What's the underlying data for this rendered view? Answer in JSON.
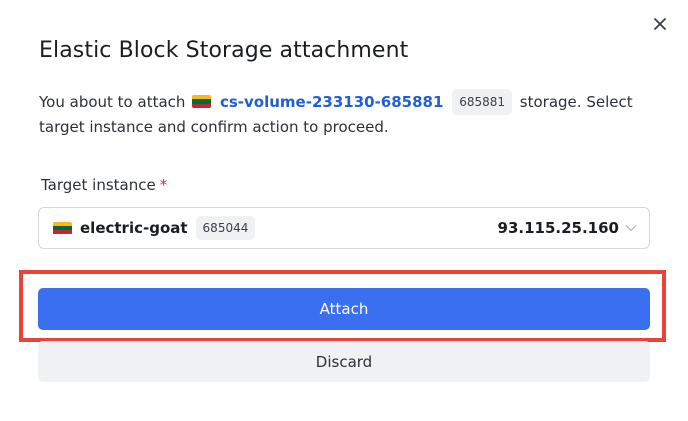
{
  "dialog": {
    "title": "Elastic Block Storage attachment",
    "close_icon": "close-icon",
    "description": {
      "prefix": "You about to attach",
      "volume_name": "cs-volume-233130-685881",
      "volume_id": "685881",
      "suffix": "storage. Select target instance and confirm action to proceed."
    },
    "target_field": {
      "label": "Target instance",
      "required_mark": "*",
      "selected": {
        "name": "electric-goat",
        "id": "685044",
        "ip": "93.115.25.160"
      },
      "chevron_icon": "chevron-down-icon"
    },
    "buttons": {
      "attach": "Attach",
      "discard": "Discard"
    },
    "flag_icon": "lithuania-flag-icon",
    "colors": {
      "primary": "#3a6ff1",
      "link": "#1f5fd6",
      "required": "#d93025",
      "highlight": "#e8443a",
      "flag_yellow": "#fdb913",
      "flag_green": "#006a44",
      "flag_red": "#c1272d"
    }
  }
}
